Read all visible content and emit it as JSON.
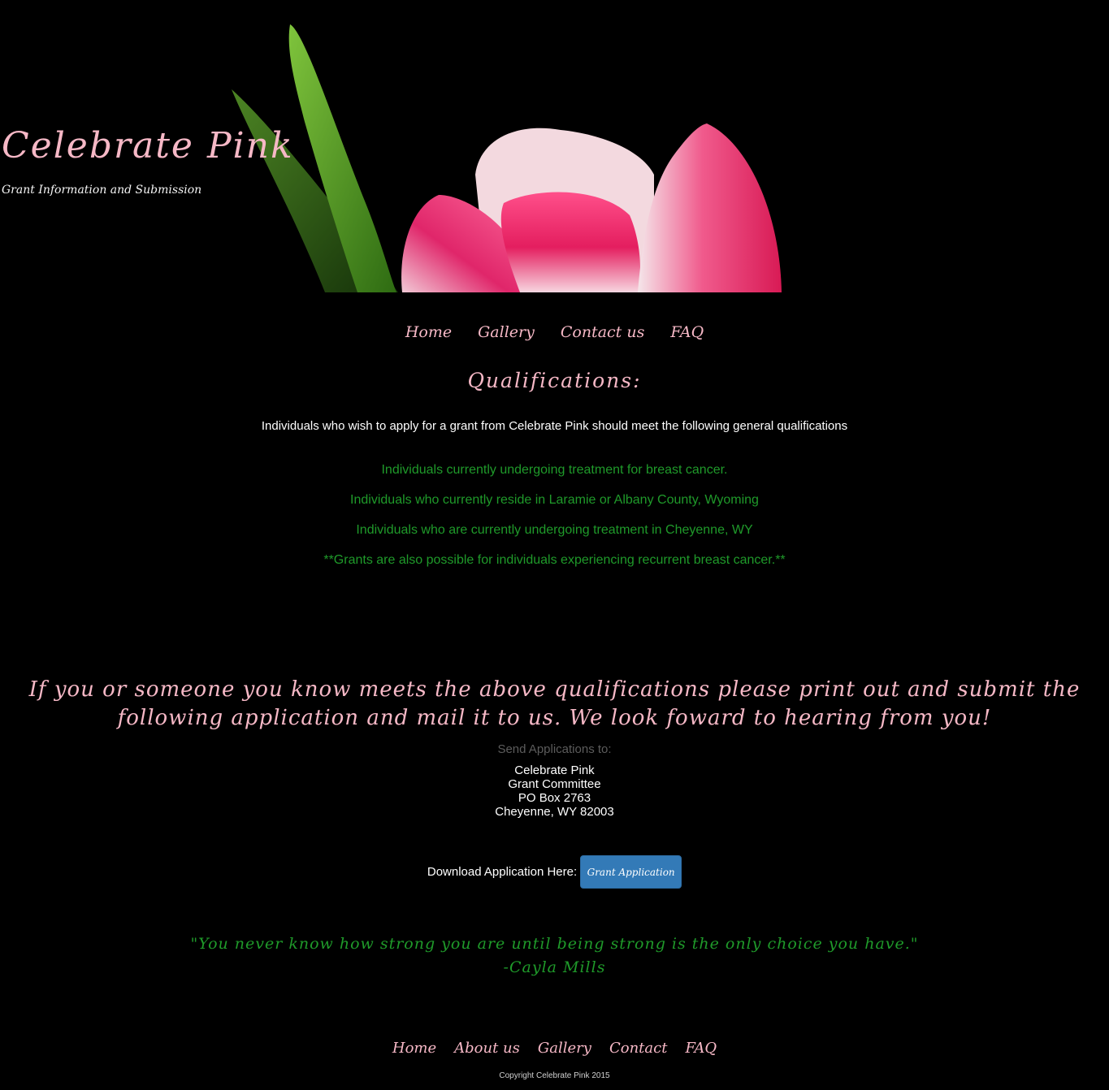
{
  "header": {
    "title": "Celebrate Pink",
    "tagline": "Grant Information and Submission"
  },
  "top_nav": {
    "items": [
      "Home",
      "Gallery",
      "Contact us",
      "FAQ"
    ]
  },
  "main": {
    "heading": "Qualifications:",
    "intro": "Individuals who wish to apply for a grant from Celebrate Pink should meet the following general qualifications",
    "qualifications": [
      "Individuals currently undergoing treatment for breast cancer.",
      "Individuals who currently reside in Laramie or Albany County, Wyoming",
      "Individuals who are currently undergoing treatment in Cheyenne, WY",
      "**Grants are also possible for individuals experiencing recurrent breast cancer.**"
    ],
    "call_to_action": "If you or someone you know meets the above qualifications please print out and submit the following application and mail it to us. We look foward to hearing from you!",
    "send_label": "Send Applications to:",
    "address": [
      "Celebrate Pink",
      "Grant Committee",
      "PO Box 2763",
      "Cheyenne, WY 82003"
    ],
    "download_label": "Download Application Here:",
    "download_button": "Grant Application",
    "quote": "\"You never know how strong you are until being strong is the only choice you have.\"",
    "quote_author": "-Cayla Mills"
  },
  "footer": {
    "nav": [
      "Home",
      "About us",
      "Gallery",
      "Contact",
      "FAQ"
    ],
    "copyright": "Copyright Celebrate Pink 2015"
  },
  "colors": {
    "background": "#000000",
    "accent_pink": "#f6b8c6",
    "accent_green": "#1f9a2a",
    "button_blue": "#337ab7"
  }
}
